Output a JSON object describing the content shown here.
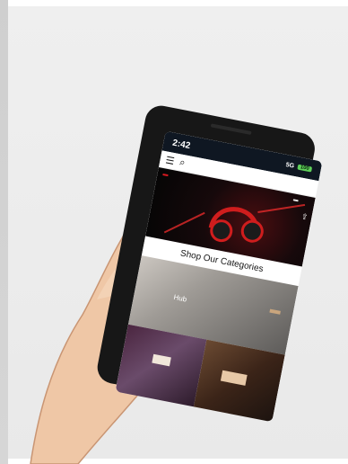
{
  "phone_screen": {
    "status_bar": {
      "time": "2:42",
      "network": "5G",
      "battery": "100"
    },
    "app_bar": {
      "menu_icon": "menu-icon",
      "search_icon": "search-icon"
    },
    "hero": {
      "badge": "",
      "share_icon": "share-icon"
    },
    "categories": {
      "heading": "Shop Our Categories",
      "items": [
        {
          "label": "Hub"
        }
      ]
    }
  }
}
